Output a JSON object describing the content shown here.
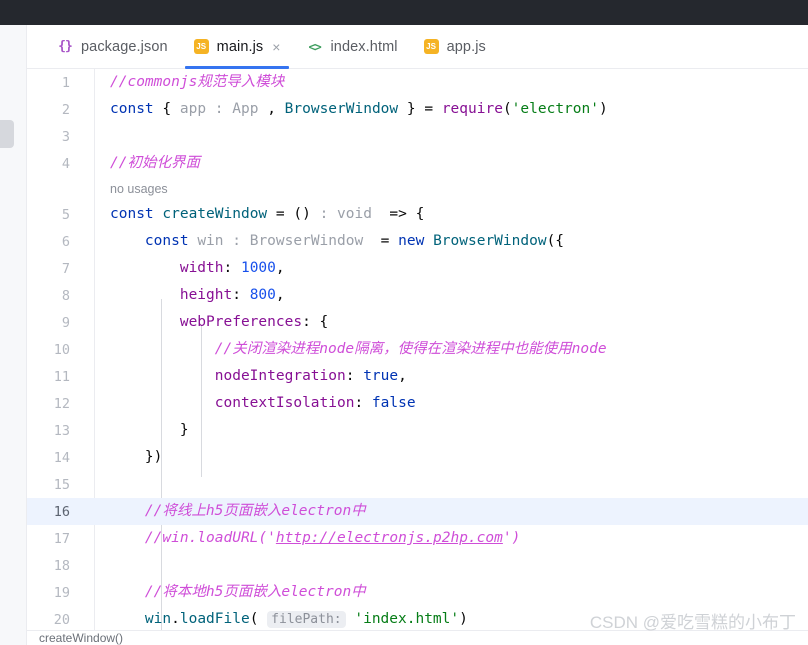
{
  "window": {
    "titlebar_color": "#25282e",
    "accent_color": "#3574f0"
  },
  "tabs": [
    {
      "label": "package.json",
      "icon": "json-braces-icon",
      "icon_text": "{}",
      "active": false,
      "closable": false
    },
    {
      "label": "main.js",
      "icon": "js-file-icon",
      "icon_text": "JS",
      "active": true,
      "closable": true,
      "close_glyph": "×"
    },
    {
      "label": "index.html",
      "icon": "html-file-icon",
      "icon_text": "<>",
      "active": false,
      "closable": false
    },
    {
      "label": "app.js",
      "icon": "js-file-icon",
      "icon_text": "JS",
      "active": false,
      "closable": false
    }
  ],
  "editor": {
    "language": "JavaScript",
    "current_line": 16,
    "inlay_hints": {
      "no_usages": "no usages",
      "file_path_param": "filePath:"
    },
    "lines": [
      {
        "no": "1",
        "text": "//commonjs规范导入模块"
      },
      {
        "no": "2",
        "text": "const { app : App , BrowserWindow } = require('electron')"
      },
      {
        "no": "3",
        "text": ""
      },
      {
        "no": "4",
        "text": "//初始化界面"
      },
      {
        "no": "",
        "text": "no usages"
      },
      {
        "no": "5",
        "text": "const createWindow = () : void  => {"
      },
      {
        "no": "6",
        "text": "    const win : BrowserWindow  = new BrowserWindow({"
      },
      {
        "no": "7",
        "text": "        width: 1000,"
      },
      {
        "no": "8",
        "text": "        height: 800,"
      },
      {
        "no": "9",
        "text": "        webPreferences: {"
      },
      {
        "no": "10",
        "text": "            //关闭渲染进程node隔离，使得在渲染进程中也能使用node"
      },
      {
        "no": "11",
        "text": "            nodeIntegration: true,"
      },
      {
        "no": "12",
        "text": "            contextIsolation: false"
      },
      {
        "no": "13",
        "text": "        }"
      },
      {
        "no": "14",
        "text": "    })"
      },
      {
        "no": "15",
        "text": ""
      },
      {
        "no": "16",
        "text": "    //将线上h5页面嵌入electron中"
      },
      {
        "no": "17",
        "text": "    //win.loadURL('http://electronjs.p2hp.com')"
      },
      {
        "no": "18",
        "text": ""
      },
      {
        "no": "19",
        "text": "    //将本地h5页面嵌入electron中"
      },
      {
        "no": "20",
        "text": "    win.loadFile( filePath: 'index.html')"
      }
    ],
    "tokens": {
      "keyword_const": "const",
      "keyword_new": "new",
      "identifier_app": "app",
      "type_app": ": App",
      "identifier_browserwindow": "BrowserWindow",
      "function_require": "require",
      "string_electron": "'electron'",
      "identifier_createwindow": "createWindow",
      "type_void": ": void",
      "identifier_win": "win",
      "type_browserwindow": ": BrowserWindow",
      "prop_width": "width",
      "value_width": "1000",
      "prop_height": "height",
      "value_height": "800",
      "prop_webpreferences": "webPreferences",
      "prop_nodeintegration": "nodeIntegration",
      "value_true": "true",
      "prop_contextisolation": "contextIsolation",
      "value_false": "false",
      "identifier_win2": "win",
      "method_loadfile": "loadFile",
      "string_indexhtml": "'index.html'",
      "url_electronjs": "http://electronjs.p2hp.com"
    }
  },
  "breadcrumb": {
    "path": "createWindow()"
  },
  "watermark": {
    "text": "CSDN @爱吃雪糕的小布丁"
  }
}
